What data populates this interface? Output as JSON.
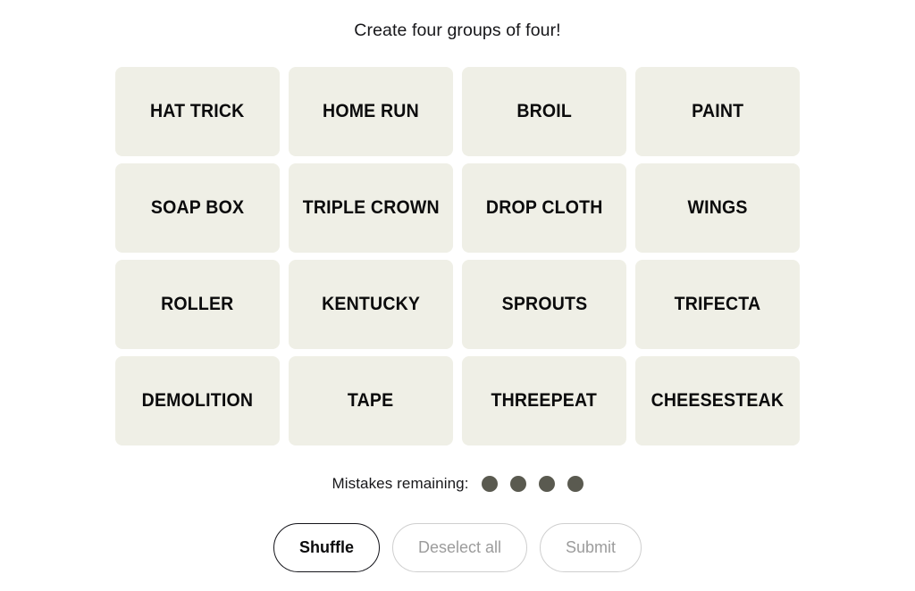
{
  "page": {
    "title": "Create four groups of four!",
    "background_color": "#ffffff"
  },
  "theme": {
    "tile_bg": "#efefe6",
    "tile_text": "#0b0b0c",
    "dot_color": "#5a5a50",
    "enabled_border": "#14141a",
    "disabled_border": "#cfcfcf",
    "disabled_text": "#9c9c9c"
  },
  "grid": {
    "rows": 4,
    "columns": 4,
    "tiles": [
      {
        "label": "HAT TRICK"
      },
      {
        "label": "HOME RUN"
      },
      {
        "label": "BROIL"
      },
      {
        "label": "PAINT"
      },
      {
        "label": "SOAP BOX"
      },
      {
        "label": "TRIPLE CROWN"
      },
      {
        "label": "DROP CLOTH"
      },
      {
        "label": "WINGS"
      },
      {
        "label": "ROLLER"
      },
      {
        "label": "KENTUCKY"
      },
      {
        "label": "SPROUTS"
      },
      {
        "label": "TRIFECTA"
      },
      {
        "label": "DEMOLITION"
      },
      {
        "label": "TAPE"
      },
      {
        "label": "THREEPEAT"
      },
      {
        "label": "CHEESESTEAK"
      }
    ]
  },
  "mistakes": {
    "label": "Mistakes remaining:",
    "remaining": 4,
    "dots": [
      {
        "state": "filled"
      },
      {
        "state": "filled"
      },
      {
        "state": "filled"
      },
      {
        "state": "filled"
      }
    ]
  },
  "controls": {
    "shuffle_label": "Shuffle",
    "shuffle_state": "enabled",
    "deselect_label": "Deselect all",
    "deselect_state": "disabled",
    "submit_label": "Submit",
    "submit_state": "disabled"
  }
}
